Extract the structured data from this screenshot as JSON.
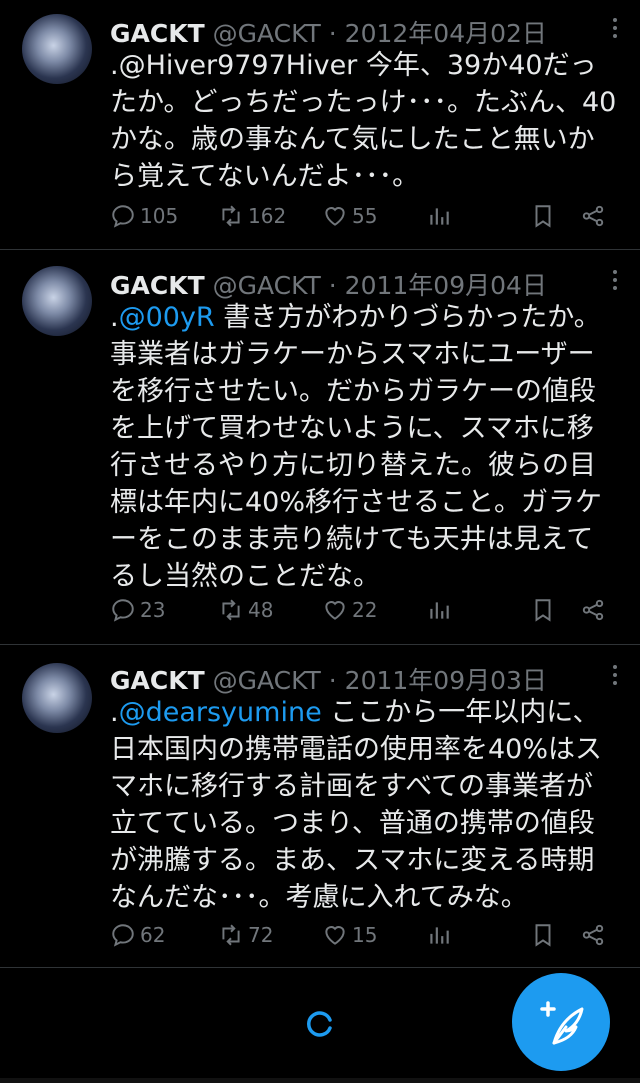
{
  "tweets": [
    {
      "name": "GACKT",
      "meta": "@GACKT · 2012年04月02日",
      "mention": ".@Hiver9797Hiver",
      "mention_is_link": false,
      "text": " 今年、39か40だったか。どっちだったっけ･･･。たぶん、40かな。歳の事なんて気にしたこと無いから覚えてないんだよ･･･。",
      "replies": "105",
      "retweets": "162",
      "likes": "55"
    },
    {
      "name": "GACKT",
      "meta": "@GACKT · 2011年09月04日",
      "prefix": ".",
      "mention": "@00yR",
      "mention_is_link": true,
      "text": " 書き方がわかりづらかったか。事業者はガラケーからスマホにユーザーを移行させたい。だからガラケーの値段を上げて買わせないように、スマホに移行させるやり方に切り替えた。彼らの目標は年内に40%移行させること。ガラケーをこのまま売り続けても天井は見えてるし当然のことだな。",
      "replies": "23",
      "retweets": "48",
      "likes": "22"
    },
    {
      "name": "GACKT",
      "meta": "@GACKT · 2011年09月03日",
      "prefix": ".",
      "mention": "@dearsyumine",
      "mention_is_link": true,
      "text": " ここから一年以内に、日本国内の携帯電話の使用率を40%はスマホに移行する計画をすべての事業者が立てている。つまり、普通の携帯の値段が沸騰する。まあ、スマホに変える時期なんだな･･･。考慮に入れてみな。",
      "replies": "62",
      "retweets": "72",
      "likes": "15"
    }
  ],
  "icons": [
    "more-icon",
    "reply-icon",
    "retweet-icon",
    "like-icon",
    "views-icon",
    "bookmark-icon",
    "share-icon",
    "compose-icon",
    "loading-icon"
  ],
  "colors": {
    "accent": "#1d9bf0",
    "muted": "#71767b",
    "text": "#e7e9ea",
    "bg": "#000000"
  }
}
